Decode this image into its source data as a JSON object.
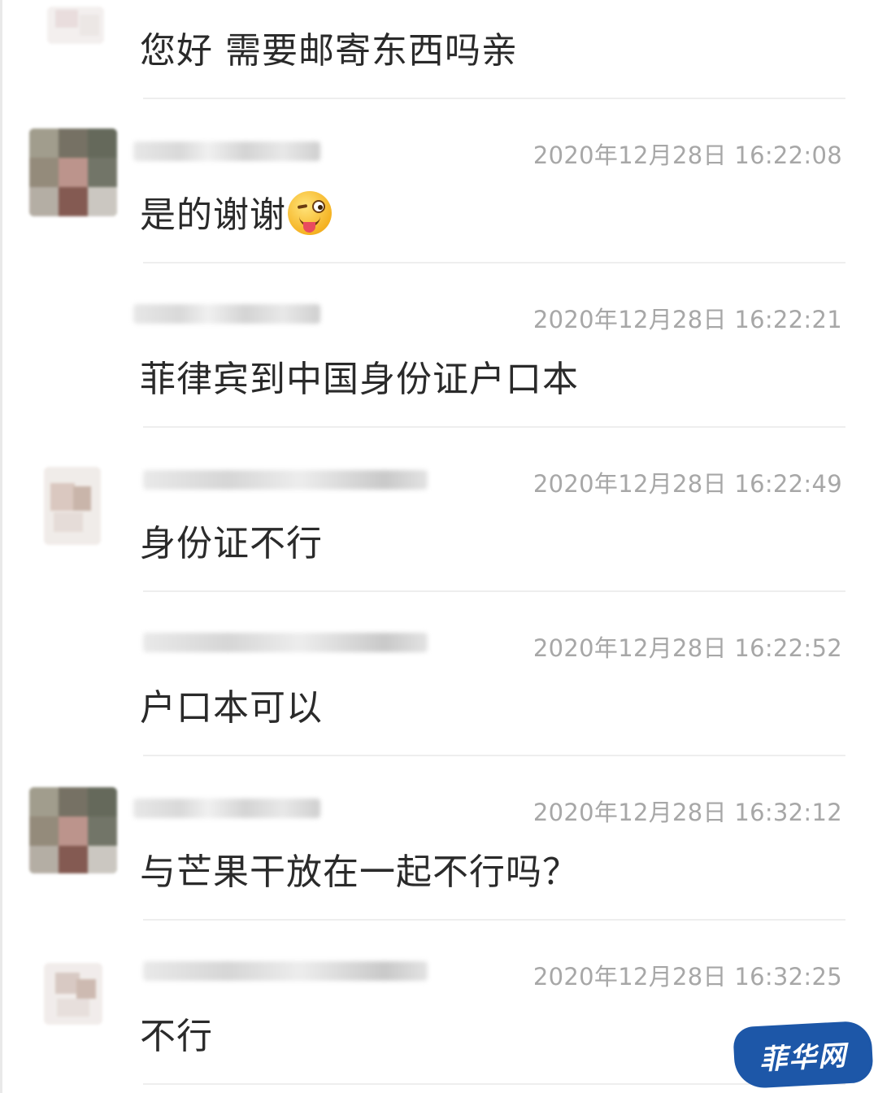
{
  "messages": [
    {
      "sender": "",
      "time": "",
      "text": "您好  需要邮寄东西吗亲",
      "emoji": ""
    },
    {
      "sender": "",
      "time": "2020年12月28日 16:22:08",
      "text": "是的谢谢",
      "emoji": "winking-tongue-emoji"
    },
    {
      "sender": "",
      "time": "2020年12月28日 16:22:21",
      "text": "菲律宾到中国身份证户口本",
      "emoji": ""
    },
    {
      "sender": "",
      "time": "2020年12月28日 16:22:49",
      "text": "身份证不行",
      "emoji": ""
    },
    {
      "sender": "",
      "time": "2020年12月28日 16:22:52",
      "text": "户口本可以",
      "emoji": ""
    },
    {
      "sender": "",
      "time": "2020年12月28日 16:32:12",
      "text": "与芒果干放在一起不行吗？",
      "emoji": ""
    },
    {
      "sender": "",
      "time": "2020年12月28日 16:32:25",
      "text": "不行",
      "emoji": ""
    }
  ],
  "watermark": {
    "text": "菲华网",
    "color": "#1d57a8"
  },
  "colors": {
    "timestamp": "#a7a7a7",
    "message_text": "#2a2a2a",
    "divider": "#eeeeee"
  }
}
